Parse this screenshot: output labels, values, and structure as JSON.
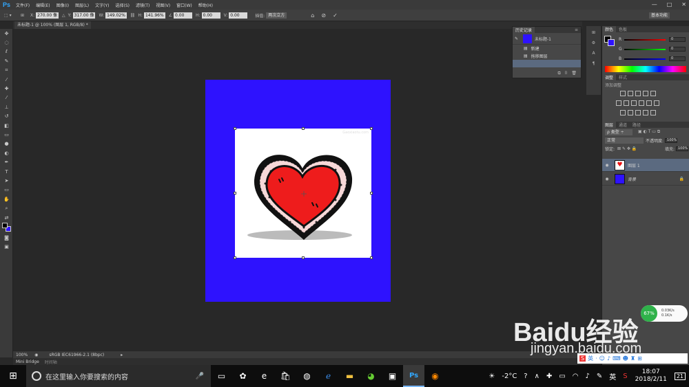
{
  "app": {
    "logo": "Ps"
  },
  "menu": [
    "文件(F)",
    "编辑(E)",
    "图像(I)",
    "图层(L)",
    "文字(Y)",
    "选择(S)",
    "滤镜(T)",
    "视图(V)",
    "窗口(W)",
    "帮助(H)"
  ],
  "window_buttons": [
    "—",
    "□",
    "✕"
  ],
  "options_bar": {
    "x_label": "X:",
    "x_value": "270.00 像",
    "y_label": "Y:",
    "y_value": "317.00 像",
    "w_label": "W:",
    "w_value": "149.02%",
    "h_label": "H:",
    "h_value": "141.96%",
    "angle_value": "0.00",
    "hskew_label": "H:",
    "hskew_value": "0.00",
    "vskew_label": "V:",
    "vskew_value": "0.00",
    "interp_label": "插值:",
    "interp_value": "两次立方",
    "workspace": "基本功能"
  },
  "document": {
    "tab_title": "未标题-1 @ 100% (图层 1, RGB/8) *",
    "background_color": "#2e12fe",
    "watermark": "Gaoxiaotu.com"
  },
  "status": {
    "zoom": "100%",
    "profile": "sRGB IEC61966-2.1 (8bpc)"
  },
  "bottom_tabs": [
    "Mini Bridge",
    "时间轴"
  ],
  "history": {
    "tabs": [
      "历史记录"
    ],
    "snapshot": "未标题-1",
    "items": [
      "新建",
      "拖移图层"
    ]
  },
  "color_panel": {
    "tabs": [
      "颜色",
      "色板"
    ],
    "channels": [
      {
        "name": "R",
        "value": "0"
      },
      {
        "name": "G",
        "value": "0"
      },
      {
        "name": "B",
        "value": "0"
      }
    ],
    "foreground": "#000000",
    "background": "#2e12fe"
  },
  "adjustments": {
    "tabs": [
      "调整",
      "样式"
    ],
    "hint": "添加调整"
  },
  "layers": {
    "tabs": [
      "图层",
      "通道",
      "路径"
    ],
    "blend_mode": "正常",
    "opacity_label": "不透明度:",
    "opacity": "100%",
    "lock_label": "锁定:",
    "fill_label": "填充:",
    "fill": "100%",
    "items": [
      {
        "name": "图层 1"
      },
      {
        "name": "背景"
      }
    ]
  },
  "taskbar": {
    "search_placeholder": "在这里输入你要搜索的内容",
    "weather": "-2°C",
    "ime": "英",
    "time": "18:07",
    "date": "2018/2/11",
    "notifications": "21"
  },
  "net_meter": {
    "percent": "67%",
    "up": "0.03K/s",
    "down": "0.1K/s"
  },
  "watermark_brand": {
    "text": "Baidu经验",
    "url": "jingyan.baidu.com"
  }
}
